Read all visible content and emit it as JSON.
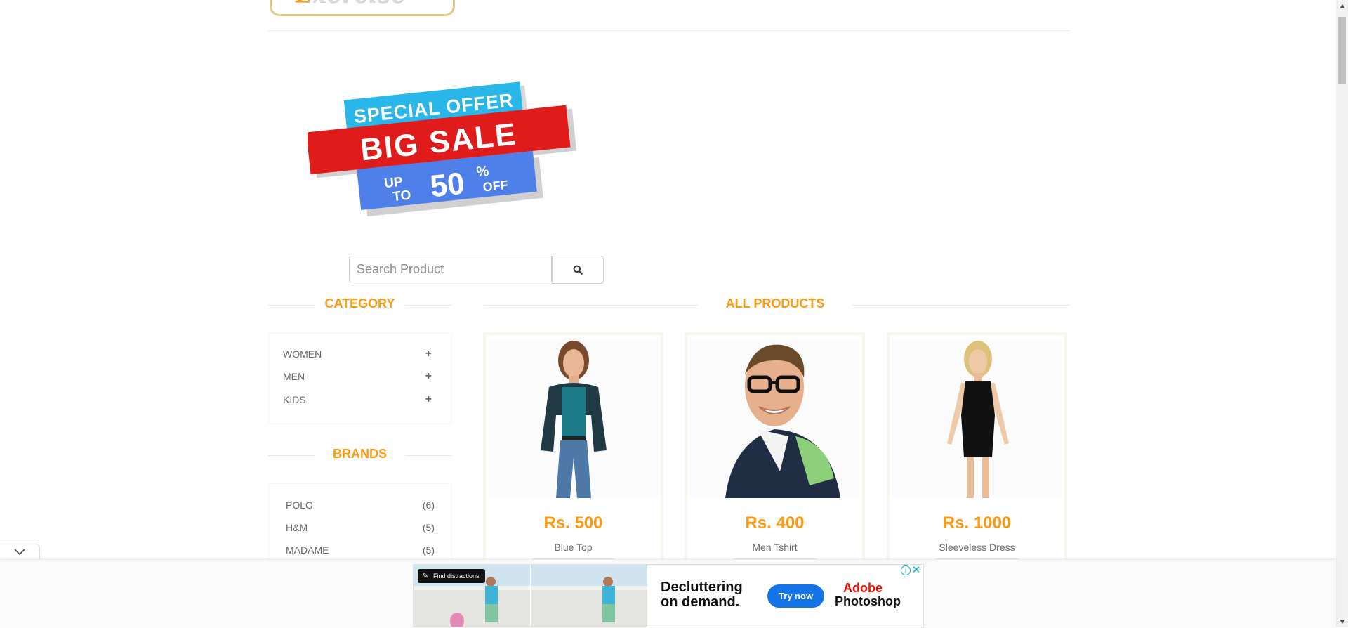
{
  "logo": {
    "text": "E",
    "text_rest": "xercise"
  },
  "banner": {
    "line1": "SPECIAL OFFER",
    "line2": "BIG SALE",
    "up": "UP",
    "to": "TO",
    "percent": "50",
    "pct_sign": "%",
    "off": "OFF"
  },
  "search": {
    "placeholder": "Search Product",
    "icon": "search-icon"
  },
  "sidebar": {
    "category_title": "Category",
    "categories": [
      {
        "label": "WOMEN",
        "icon": "plus-icon"
      },
      {
        "label": "MEN",
        "icon": "plus-icon"
      },
      {
        "label": "KIDS",
        "icon": "plus-icon"
      }
    ],
    "brands_title": "Brands",
    "brands": [
      {
        "label": "POLO",
        "count": "(6)"
      },
      {
        "label": "H&M",
        "count": "(5)"
      },
      {
        "label": "MADAME",
        "count": "(5)"
      }
    ]
  },
  "main": {
    "title": "All Products",
    "products": [
      {
        "price": "Rs. 500",
        "name": "Blue Top"
      },
      {
        "price": "Rs. 400",
        "name": "Men Tshirt"
      },
      {
        "price": "Rs. 1000",
        "name": "Sleeveless Dress"
      }
    ]
  },
  "ad": {
    "chip": "Find distractions",
    "headline1": "Decluttering",
    "headline2": "on demand.",
    "cta": "Try now",
    "brand1": "Adobe",
    "brand2": "Photoshop",
    "info_icon": "info-icon",
    "close_icon": "close-icon"
  },
  "colors": {
    "accent": "#fe980f",
    "text": "#696763",
    "ad_button": "#1473e6"
  }
}
